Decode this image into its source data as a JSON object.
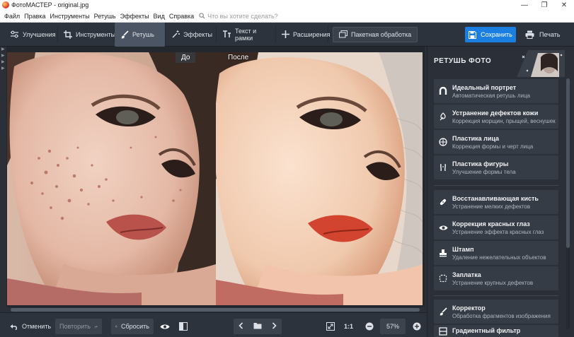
{
  "window": {
    "title": "ФотоМАСТЕР - original.jpg"
  },
  "menu": {
    "items": [
      "Файл",
      "Правка",
      "Инструменты",
      "Ретушь",
      "Эффекты",
      "Вид",
      "Справка"
    ],
    "search_placeholder": "Что вы хотите сделать?"
  },
  "toolbar": {
    "tabs": [
      "Улучшения",
      "Инструменты",
      "Ретушь",
      "Эффекты",
      "Текст и рамки",
      "Расширения"
    ],
    "active_tab": "Ретушь",
    "batch_label": "Пакетная обработка",
    "save_label": "Сохранить",
    "print_label": "Печать",
    "accent_color": "#1a7fe0"
  },
  "canvas": {
    "before_label": "До",
    "after_label": "После"
  },
  "panel": {
    "title": "РЕТУШЬ ФОТО",
    "tools": [
      {
        "name": "Идеальный портрет",
        "desc": "Автоматическая ретушь лица",
        "icon": "magnet-icon"
      },
      {
        "name": "Устранение дефектов кожи",
        "desc": "Коррекция морщин, прыщей, веснушек",
        "icon": "skin-brush-icon"
      },
      {
        "name": "Пластика лица",
        "desc": "Коррекция формы и черт лица",
        "icon": "face-icon"
      },
      {
        "name": "Пластика фигуры",
        "desc": "Улучшение формы тела",
        "icon": "figure-icon"
      },
      {
        "name": "Восстанавливающая кисть",
        "desc": "Устранение мелких дефектов",
        "icon": "healing-brush-icon"
      },
      {
        "name": "Коррекция красных глаз",
        "desc": "Устранение эффекта красных глаз",
        "icon": "eye-icon"
      },
      {
        "name": "Штамп",
        "desc": "Удаление нежелательных объектов",
        "icon": "stamp-icon"
      },
      {
        "name": "Заплатка",
        "desc": "Устранение крупных дефектов",
        "icon": "patch-icon"
      },
      {
        "name": "Корректор",
        "desc": "Обработка фрагментов изображения",
        "icon": "corrector-brush-icon"
      },
      {
        "name": "Градиентный фильтр",
        "desc": "",
        "icon": "gradient-icon"
      }
    ]
  },
  "bottom": {
    "undo_label": "Отменить",
    "redo_label": "Повторить",
    "reset_label": "Сбросить",
    "one_to_one": "1:1",
    "zoom": "57%"
  }
}
